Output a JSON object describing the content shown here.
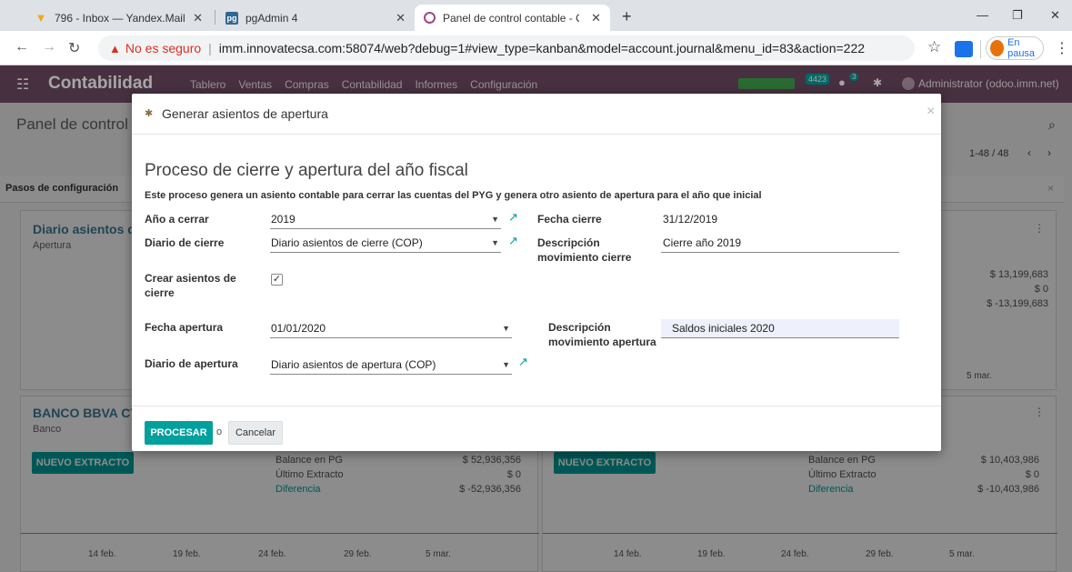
{
  "browser": {
    "tabs": [
      {
        "title": "796 - Inbox — Yandex.Mail",
        "active": false
      },
      {
        "title": "pgAdmin 4",
        "active": false
      },
      {
        "title": "Panel de control contable - Odoo",
        "active": true
      }
    ],
    "not_secure_label": "No es seguro",
    "url": "imm.innovatecsa.com:58074/web?debug=1#view_type=kanban&model=account.journal&menu_id=83&action=222",
    "pause_label": "En pausa",
    "window_controls": {
      "minimize": "—",
      "restore": "❐",
      "close": "✕"
    }
  },
  "navbar": {
    "app_title": "Contabilidad",
    "menu": [
      "Tablero",
      "Ventas",
      "Compras",
      "Contabilidad",
      "Informes",
      "Configuración"
    ],
    "badge_count": "4423",
    "chat_count": "3",
    "user": "Administrator (odoo.imm.net)"
  },
  "control_panel": {
    "title": "Panel de control",
    "pager": "1-48 / 48",
    "setup_banner": "Pasos de configuración"
  },
  "kanban": {
    "card1": {
      "title": "Diario asientos d",
      "subtitle": "Apertura",
      "right_values": [
        "$ 13,199,683",
        "$ 0",
        "$ -13,199,683"
      ],
      "date_tail": "5 mar."
    },
    "card2": {
      "title": "BANCO BBVA CT",
      "subtitle": "Banco",
      "button": "NUEVO EXTRACTO",
      "balance_label": "Balance en PG",
      "balance_value": "$ 52,936,356",
      "last_label": "Último Extracto",
      "last_value": "$ 0",
      "diff_label": "Diferencia",
      "diff_value": "$ -52,936,356",
      "dates": [
        "14 feb.",
        "19 feb.",
        "24 feb.",
        "29 feb.",
        "5 mar."
      ]
    },
    "card3": {
      "button": "NUEVO EXTRACTO",
      "balance_label": "Balance en PG",
      "balance_value": "$ 10,403,986",
      "last_label": "Último Extracto",
      "last_value": "$ 0",
      "diff_label": "Diferencia",
      "diff_value": "$ -10,403,986",
      "dates": [
        "14 feb.",
        "19 feb.",
        "24 feb.",
        "29 feb.",
        "5 mar."
      ]
    }
  },
  "modal": {
    "title": "Generar asientos de apertura",
    "close": "×",
    "heading": "Proceso de cierre y apertura del año fiscal",
    "description": "Este proceso genera un asiento contable para cerrar las cuentas del PYG y genera otro asiento de apertura para el año que inicial",
    "fields": {
      "year_label": "Año a cerrar",
      "year_value": "2019",
      "close_date_label": "Fecha cierre",
      "close_date_value": "31/12/2019",
      "close_journal_label": "Diario de cierre",
      "close_journal_value": "Diario asientos de cierre (COP)",
      "close_desc_label_1": "Descripción",
      "close_desc_label_2": "movimiento cierre",
      "close_desc_value": "Cierre año 2019",
      "create_label_1": "Crear asientos de",
      "create_label_2": "cierre",
      "create_checked": true,
      "open_date_label": "Fecha apertura",
      "open_date_value": "01/01/2020",
      "open_desc_label_1": "Descripción",
      "open_desc_label_2": "movimiento apertura",
      "open_desc_value": "Saldos iniciales 2020",
      "open_journal_label": "Diario de apertura",
      "open_journal_value": "Diario asientos de apertura (COP)"
    },
    "footer": {
      "process_label": "PROCESAR",
      "or_label": "o",
      "cancel_label": "Cancelar"
    }
  },
  "colors": {
    "navbar": "#6d4a63",
    "primary": "#00a09d",
    "secure_warning": "#d93025"
  }
}
